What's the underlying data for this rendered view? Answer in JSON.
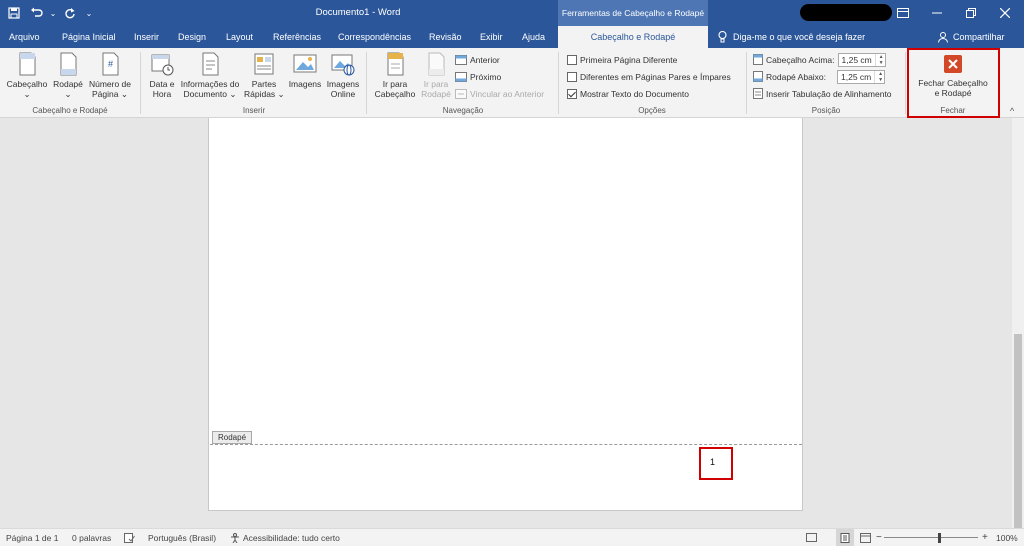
{
  "title_bar": {
    "document_title": "Documento1  -  Word",
    "context_header": "Ferramentas de Cabeçalho e Rodapé"
  },
  "tabs": [
    {
      "label": "Arquivo"
    },
    {
      "label": "Página Inicial"
    },
    {
      "label": "Inserir"
    },
    {
      "label": "Design"
    },
    {
      "label": "Layout"
    },
    {
      "label": "Referências"
    },
    {
      "label": "Correspondências"
    },
    {
      "label": "Revisão"
    },
    {
      "label": "Exibir"
    },
    {
      "label": "Ajuda"
    },
    {
      "label": "Cabeçalho e Rodapé"
    }
  ],
  "tell_me": "Diga-me o que você deseja fazer",
  "share": "Compartilhar",
  "ribbon": {
    "header_footer_group": {
      "label": "Cabeçalho e Rodapé",
      "header_btn": [
        "Cabeçalho",
        "⌄"
      ],
      "footer_btn": [
        "Rodapé",
        "⌄"
      ],
      "page_number_btn": [
        "Número de",
        "Página ⌄"
      ]
    },
    "insert_group": {
      "label": "Inserir",
      "date_time_btn": [
        "Data e",
        "Hora"
      ],
      "doc_info_btn": [
        "Informações do",
        "Documento ⌄"
      ],
      "quick_parts_btn": [
        "Partes",
        "Rápidas ⌄"
      ],
      "images_btn": [
        "Imagens"
      ],
      "online_images_btn": [
        "Imagens",
        "Online"
      ]
    },
    "navigation_group": {
      "label": "Navegação",
      "go_to_header_btn": [
        "Ir para",
        "Cabeçalho"
      ],
      "go_to_footer_btn": [
        "Ir para",
        "Rodapé"
      ],
      "previous": "Anterior",
      "next": "Próximo",
      "link_previous": "Vincular ao Anterior"
    },
    "options_group": {
      "label": "Opções",
      "different_first_page": "Primeira Página Diferente",
      "different_odd_even": "Diferentes em Páginas Pares e Ímpares",
      "show_document_text": "Mostrar Texto do Documento"
    },
    "position_group": {
      "label": "Posição",
      "header_from_top_label": "Cabeçalho Acima:",
      "header_from_top_value": "1,25 cm",
      "footer_from_bottom_label": "Rodapé Abaixo:",
      "footer_from_bottom_value": "1,25 cm",
      "insert_alignment_tab": "Inserir Tabulação de Alinhamento"
    },
    "close_group": {
      "label": "Fechar",
      "close_btn": [
        "Fechar Cabeçalho",
        "e Rodapé"
      ]
    }
  },
  "document": {
    "footer_tag": "Rodapé",
    "page_number": "1"
  },
  "status_bar": {
    "page": "Página 1 de 1",
    "words": "0 palavras",
    "language": "Português (Brasil)",
    "accessibility": "Acessibilidade: tudo certo",
    "zoom": "100%",
    "zoom_minus": "−",
    "zoom_plus": "+"
  },
  "colors": {
    "title_bar": "#2b579a",
    "context_header": "#4e76b4",
    "highlight_box": "#d00000",
    "close_icon": "#d24726"
  }
}
